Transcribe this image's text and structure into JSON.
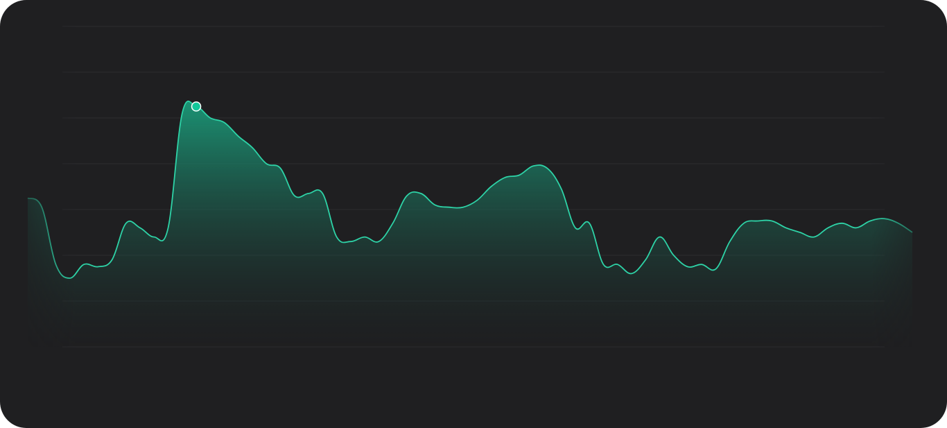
{
  "chart_data": {
    "type": "area",
    "title": "",
    "xlabel": "",
    "ylabel": "",
    "grid": true,
    "legend": "none",
    "ylim": [
      0,
      7
    ],
    "xlim": [
      0,
      63
    ],
    "x": [
      0,
      1,
      2,
      3,
      4,
      5,
      6,
      7,
      8,
      9,
      10,
      11,
      12,
      13,
      14,
      15,
      16,
      17,
      18,
      19,
      20,
      21,
      22,
      23,
      24,
      25,
      26,
      27,
      28,
      29,
      30,
      31,
      32,
      33,
      34,
      35,
      36,
      37,
      38,
      39,
      40,
      41,
      42,
      43,
      44,
      45,
      46,
      47,
      48,
      49,
      50,
      51,
      52,
      53,
      54,
      55,
      56,
      57,
      58,
      59,
      60,
      61,
      62,
      63
    ],
    "series": [
      {
        "values": [
          3.25,
          3.05,
          1.8,
          1.5,
          1.8,
          1.75,
          1.9,
          2.7,
          2.6,
          2.4,
          2.6,
          5.1,
          5.25,
          5.0,
          4.9,
          4.6,
          4.35,
          4.0,
          3.9,
          3.3,
          3.35,
          3.35,
          2.4,
          2.3,
          2.4,
          2.3,
          2.7,
          3.3,
          3.35,
          3.1,
          3.05,
          3.05,
          3.2,
          3.5,
          3.7,
          3.75,
          3.95,
          3.9,
          3.45,
          2.6,
          2.7,
          1.8,
          1.8,
          1.6,
          1.9,
          2.4,
          2.0,
          1.75,
          1.8,
          1.7,
          2.3,
          2.7,
          2.75,
          2.75,
          2.6,
          2.5,
          2.4,
          2.6,
          2.7,
          2.6,
          2.75,
          2.8,
          2.7,
          2.5
        ]
      }
    ],
    "highlight": {
      "x": 12,
      "y": 5.25
    },
    "colors": {
      "line": "#2ed3a7",
      "area_top": "#1b9a79",
      "marker_fill": "#13c79a",
      "marker_stroke": "#ffffff",
      "crosshair": "#d9d9d9",
      "grid": "#2c2c2f",
      "background": "#1f1f21"
    }
  }
}
